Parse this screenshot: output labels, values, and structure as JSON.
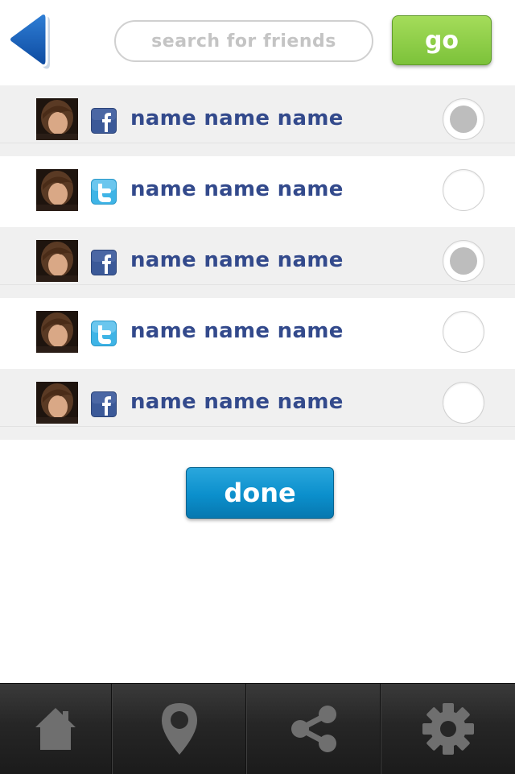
{
  "header": {
    "back_icon": "back-arrow-icon",
    "search": {
      "placeholder": "search for friends",
      "value": ""
    },
    "go_label": "go"
  },
  "friends": [
    {
      "name": "name name name",
      "network": "facebook",
      "selected": true
    },
    {
      "name": "name name name",
      "network": "twitter",
      "selected": false
    },
    {
      "name": "name name name",
      "network": "facebook",
      "selected": true
    },
    {
      "name": "name name name",
      "network": "twitter",
      "selected": false
    },
    {
      "name": "name name name",
      "network": "facebook",
      "selected": false
    }
  ],
  "done_label": "done",
  "tabbar": {
    "tabs": [
      {
        "icon": "home-icon"
      },
      {
        "icon": "location-pin-icon"
      },
      {
        "icon": "share-icon"
      },
      {
        "icon": "gear-icon"
      }
    ]
  },
  "colors": {
    "go_green": "#8fd04a",
    "done_blue": "#0b8fcc",
    "back_blue": "#1560b8",
    "name_text": "#334a8c",
    "facebook_blue": "#3b5998",
    "twitter_blue": "#3fb4e6",
    "tabbar_bg": "#262626"
  }
}
